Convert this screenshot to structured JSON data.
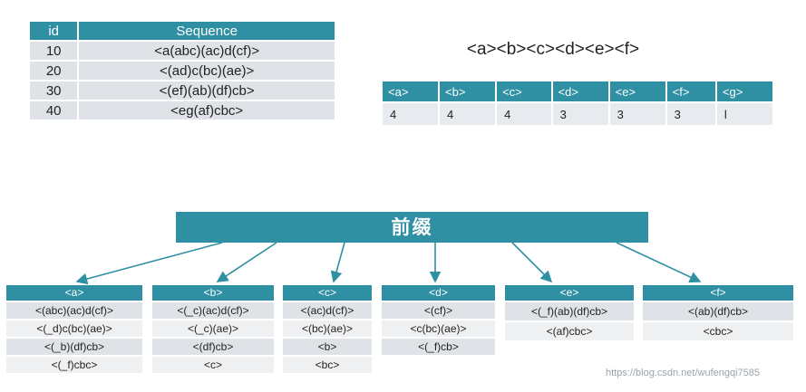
{
  "seq_table": {
    "headers": [
      "id",
      "Sequence"
    ],
    "rows": [
      [
        "10",
        "<a(abc)(ac)d(cf)>"
      ],
      [
        "20",
        "<(ad)c(bc)(ae)>"
      ],
      [
        "30",
        "<(ef)(ab)(df)cb>"
      ],
      [
        "40",
        "<eg(af)cbc>"
      ]
    ]
  },
  "freq": {
    "title": "<a><b><c><d><e><f>",
    "headers": [
      "<a>",
      "<b>",
      "<c>",
      "<d>",
      "<e>",
      "<f>",
      "<g>"
    ],
    "counts": [
      "4",
      "4",
      "4",
      "3",
      "3",
      "3",
      "l"
    ]
  },
  "prefix_label": "前缀",
  "projections": [
    {
      "header": "<a>",
      "rows": [
        "<(abc)(ac)d(cf)>",
        "<(_d)c(bc)(ae)>",
        "<(_b)(df)cb>",
        "<(_f)cbc>"
      ]
    },
    {
      "header": "<b>",
      "rows": [
        "<(_c)(ac)d(cf)>",
        "<(_c)(ae)>",
        "<(df)cb>",
        "<c>"
      ]
    },
    {
      "header": "<c>",
      "rows": [
        "<(ac)d(cf)>",
        "<(bc)(ae)>",
        "<b>",
        "<bc>"
      ]
    },
    {
      "header": "<d>",
      "rows": [
        "<(cf)>",
        "<c(bc)(ae)>",
        "<(_f)cb>"
      ]
    },
    {
      "header": "<e>",
      "rows": [
        "<(_f)(ab)(df)cb>",
        "<(af)cbc>"
      ]
    },
    {
      "header": "<f>",
      "rows": [
        "<(ab)(df)cb>",
        "<cbc>"
      ]
    }
  ],
  "watermark": "https://blog.csdn.net/wufengqi7585",
  "colors": {
    "header": "#2f8fa3",
    "cell": "#dfe3e8",
    "arrow": "#2f8fa3"
  }
}
